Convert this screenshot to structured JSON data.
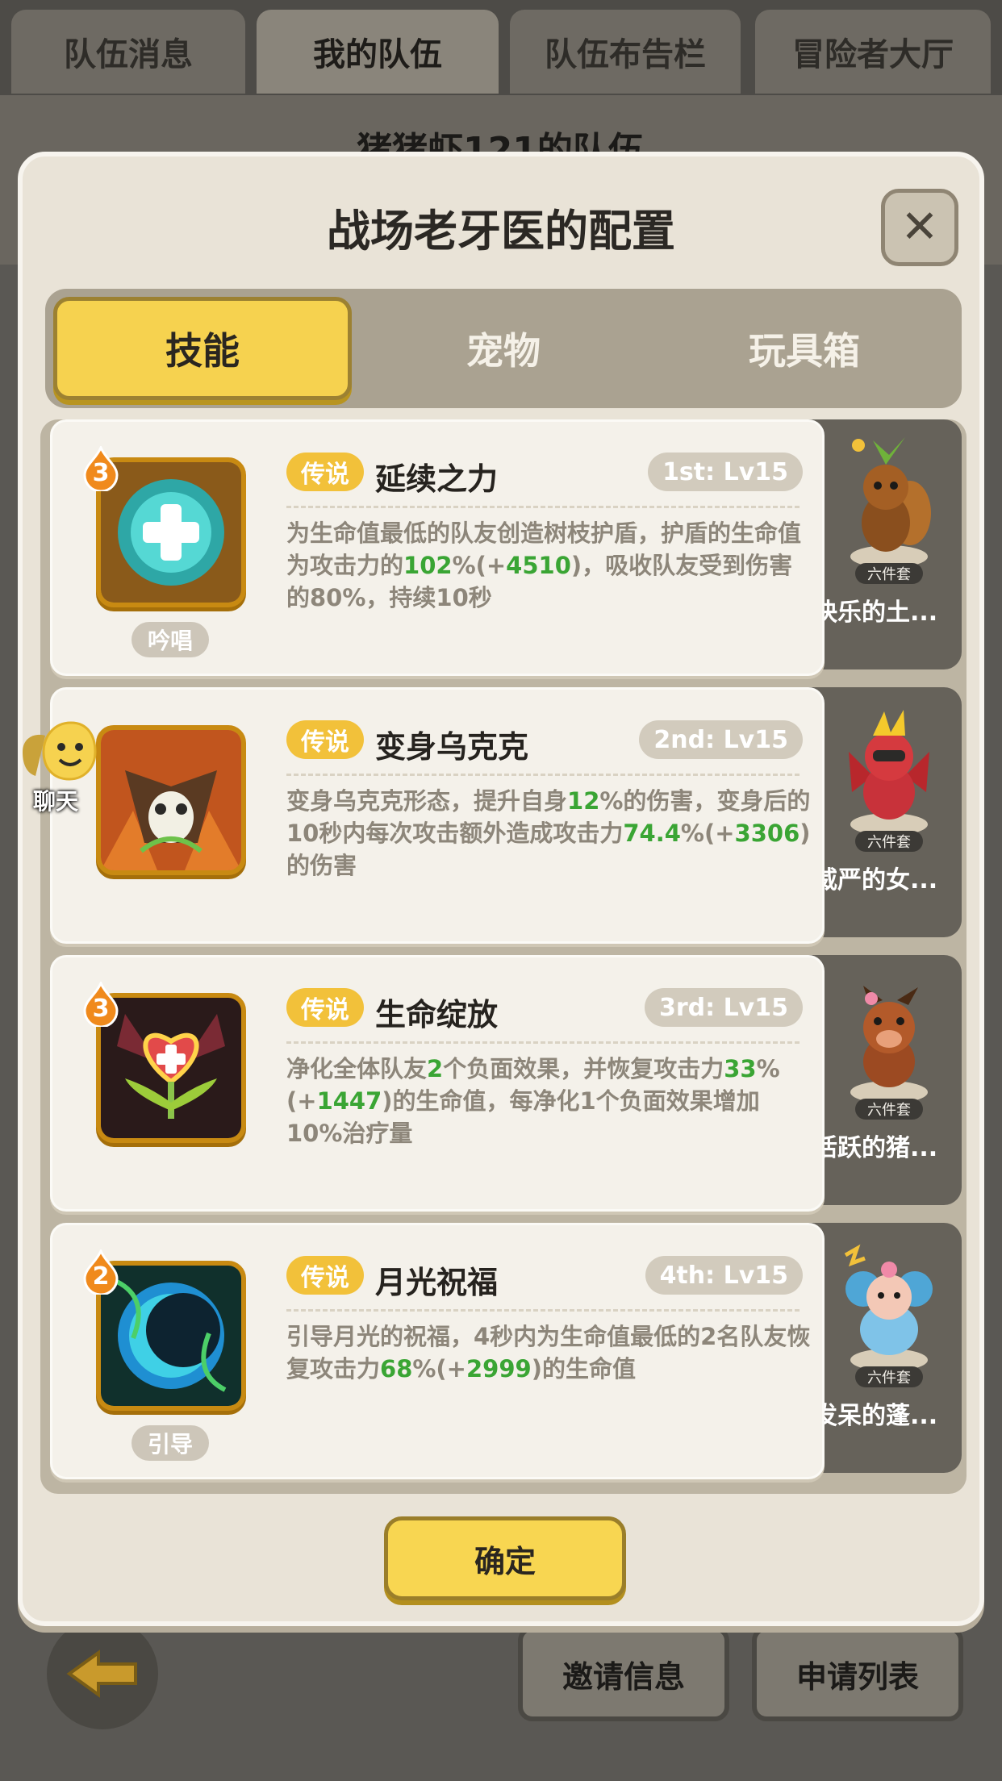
{
  "top_tabs": [
    "队伍消息",
    "我的队伍",
    "队伍布告栏",
    "冒险者大厅"
  ],
  "team_title": "猪猪虾121的队伍",
  "dialog": {
    "title": "战场老牙医的配置",
    "tabs": [
      "技能",
      "宠物",
      "玩具箱"
    ],
    "active_tab": "技能",
    "confirm_label": "确定"
  },
  "skills": [
    {
      "level_badge": "3",
      "rarity": "传说",
      "name": "延续之力",
      "slot_level": "1st: Lv15",
      "cast_type": "吟唱",
      "desc_parts": [
        "为生命值最低的队友创造树枝护盾，护盾的生命值为攻击力的",
        "102",
        "%(+",
        "4510",
        ")，吸收队友受到伤害的80%，持续10秒"
      ],
      "pet_set": "六件套",
      "pet_name": "快乐的土..."
    },
    {
      "level_badge": "",
      "rarity": "传说",
      "name": "变身乌克克",
      "slot_level": "2nd: Lv15",
      "cast_type": "",
      "desc_parts": [
        "变身乌克克形态，提升自身",
        "12",
        "%的伤害，变身后的10秒内每次攻击额外造成攻击力",
        "74.4",
        "%(+",
        "3306",
        ")的伤害"
      ],
      "pet_set": "六件套",
      "pet_name": "威严的女..."
    },
    {
      "level_badge": "3",
      "rarity": "传说",
      "name": "生命绽放",
      "slot_level": "3rd: Lv15",
      "cast_type": "",
      "desc_parts": [
        "净化全体队友",
        "2",
        "个负面效果，并恢复攻击力",
        "33",
        "%(+",
        "1447",
        ")的生命值，每净化1个负面效果增加10%治疗量"
      ],
      "pet_set": "六件套",
      "pet_name": "活跃的猪..."
    },
    {
      "level_badge": "2",
      "rarity": "传说",
      "name": "月光祝福",
      "slot_level": "4th: Lv15",
      "cast_type": "引导",
      "desc_parts": [
        "引导月光的祝福，4秒内为生命值最低的2名队友恢复攻击力",
        "68",
        "%(+",
        "2999",
        ")的生命值"
      ],
      "pet_set": "六件套",
      "pet_name": "发呆的蓬..."
    }
  ],
  "chat": {
    "label": "聊天"
  },
  "bottom": {
    "invite_label": "邀请信息",
    "apply_label": "申请列表"
  },
  "icons": {
    "close": "close-icon",
    "back": "back-arrow-icon",
    "chat": "chat-face-icon"
  },
  "colors": {
    "accent_yellow": "#f6d24f",
    "highlight_green": "#3aa534",
    "rarity_gold": "#f2c13a"
  }
}
